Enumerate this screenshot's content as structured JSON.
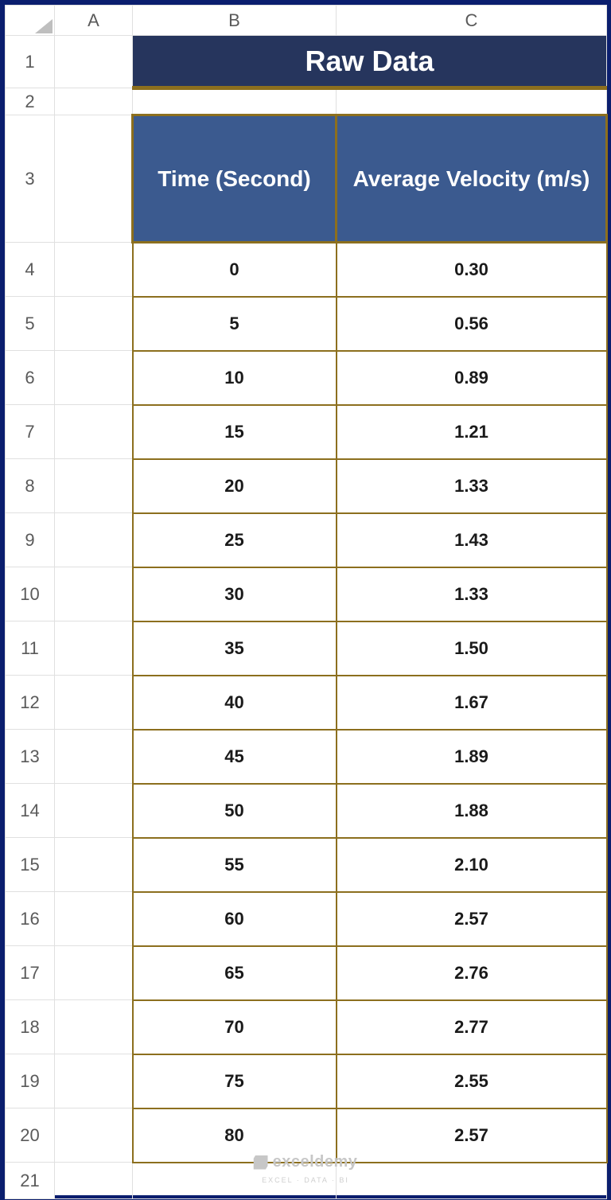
{
  "columns": [
    "A",
    "B",
    "C"
  ],
  "rows": [
    "1",
    "2",
    "3",
    "4",
    "5",
    "6",
    "7",
    "8",
    "9",
    "10",
    "11",
    "12",
    "13",
    "14",
    "15",
    "16",
    "17",
    "18",
    "19",
    "20",
    "21"
  ],
  "title": "Raw Data",
  "table": {
    "headers": [
      "Time (Second)",
      "Average Velocity (m/s)"
    ],
    "data": [
      {
        "time": "0",
        "velocity": "0.30"
      },
      {
        "time": "5",
        "velocity": "0.56"
      },
      {
        "time": "10",
        "velocity": "0.89"
      },
      {
        "time": "15",
        "velocity": "1.21"
      },
      {
        "time": "20",
        "velocity": "1.33"
      },
      {
        "time": "25",
        "velocity": "1.43"
      },
      {
        "time": "30",
        "velocity": "1.33"
      },
      {
        "time": "35",
        "velocity": "1.50"
      },
      {
        "time": "40",
        "velocity": "1.67"
      },
      {
        "time": "45",
        "velocity": "1.89"
      },
      {
        "time": "50",
        "velocity": "1.88"
      },
      {
        "time": "55",
        "velocity": "2.10"
      },
      {
        "time": "60",
        "velocity": "2.57"
      },
      {
        "time": "65",
        "velocity": "2.76"
      },
      {
        "time": "70",
        "velocity": "2.77"
      },
      {
        "time": "75",
        "velocity": "2.55"
      },
      {
        "time": "80",
        "velocity": "2.57"
      }
    ]
  },
  "watermark": {
    "brand": "exceldemy",
    "tagline": "EXCEL · DATA · BI"
  }
}
